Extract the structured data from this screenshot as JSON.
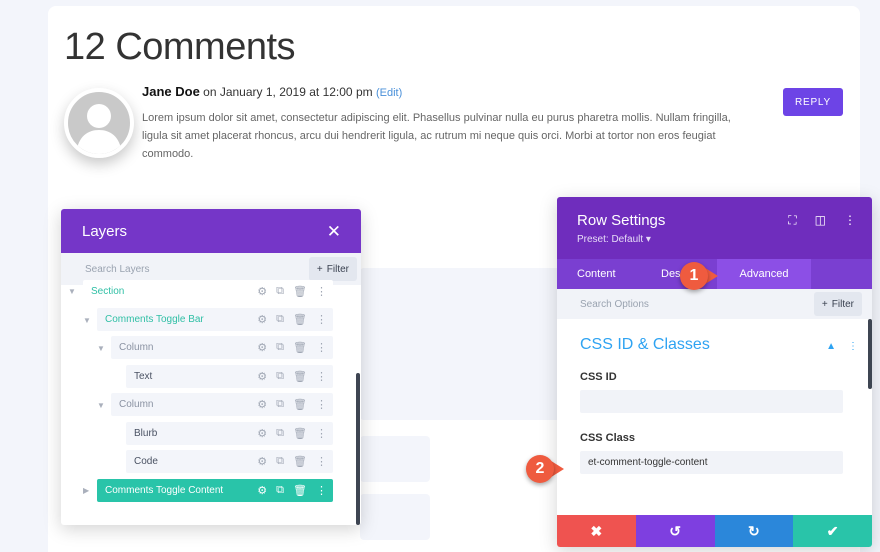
{
  "comments": {
    "title": "12 Comments",
    "author": "Jane Doe",
    "date_text": "on January 1, 2019 at 12:00 pm",
    "edit_label": "(Edit)",
    "body": "Lorem ipsum dolor sit amet, consectetur adipiscing elit. Phasellus pulvinar nulla eu purus pharetra mollis. Nullam fringilla, ligula sit amet placerat rhoncus, arcu dui hendrerit ligula, ac rutrum mi neque quis orci. Morbi at tortor non eros feugiat commodo.",
    "reply_label": "REPLY"
  },
  "layers": {
    "title": "Layers",
    "close_glyph": "✕",
    "search_placeholder": "Search Layers",
    "filter_label": "Filter",
    "items": [
      {
        "label": "Section"
      },
      {
        "label": "Comments Toggle Bar"
      },
      {
        "label": "Column"
      },
      {
        "label": "Text"
      },
      {
        "label": "Column"
      },
      {
        "label": "Blurb"
      },
      {
        "label": "Code"
      },
      {
        "label": "Comments Toggle Content"
      }
    ]
  },
  "row_settings": {
    "title": "Row Settings",
    "preset": "Preset: Default ▾",
    "tabs": [
      {
        "label": "Content"
      },
      {
        "label": "Des"
      },
      {
        "label": "Advanced"
      }
    ],
    "search_placeholder": "Search Options",
    "filter_label": "Filter",
    "section_title": "CSS ID & Classes",
    "css_id_label": "CSS ID",
    "css_id_value": "",
    "css_class_label": "CSS Class",
    "css_class_value": "et-comment-toggle-content"
  },
  "callouts": {
    "one": "1",
    "two": "2"
  },
  "colors": {
    "accent_purple": "#6f2dbd",
    "teal": "#29c4a9",
    "link_blue": "#2ea3f2",
    "cancel_red": "#ef5350",
    "undo_purple": "#7e3fe0",
    "redo_blue": "#2b87da",
    "save_green": "#29c4a9"
  }
}
